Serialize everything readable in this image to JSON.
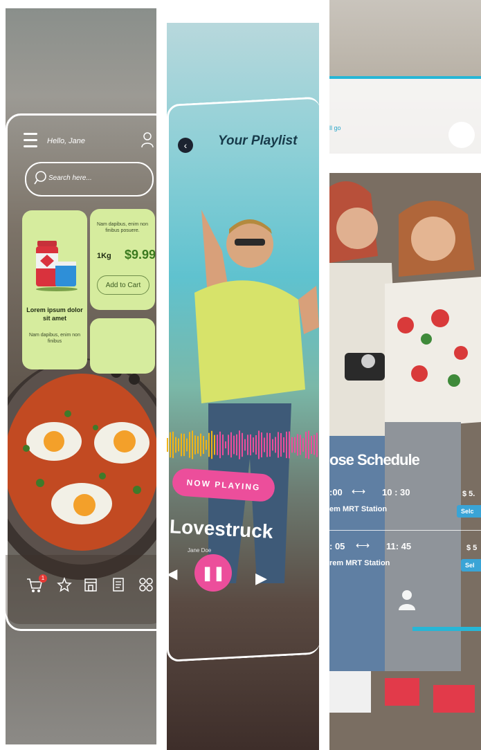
{
  "grocery": {
    "greeting": "Hello, Jane",
    "search_placeholder": "Search here...",
    "product1": {
      "title": "Lorem ipsum dolor sit amet",
      "description": "Nam dapibus, enim non finibus"
    },
    "product2": {
      "description": "Nam dapibus, enim non finibus posuere.",
      "weight": "1Kg",
      "price": "$9.99",
      "add_label": "Add to Cart"
    },
    "cart_badge": "1",
    "icons": [
      "menu-icon",
      "user-icon",
      "search-icon",
      "cart-icon",
      "star-icon",
      "store-icon",
      "receipt-icon",
      "grid-icon"
    ]
  },
  "music": {
    "title": "Your Playlist",
    "now_playing": "NOW PLAYING",
    "song": "Lovestruck",
    "artist": "Jane Doe",
    "colors": {
      "accent": "#ec4e9b",
      "wave_left": "#f2b416",
      "wave_right": "#ec4e9b"
    }
  },
  "travel": {
    "top_link": "ll go",
    "schedule_title": "ose Schedule",
    "rows": [
      {
        "depart": ":00",
        "arrive": "10 : 30",
        "station": "em MRT Station",
        "fare": "$ 5.",
        "select": "Selc"
      },
      {
        "depart": ": 05",
        "arrive": "11: 45",
        "station": "rem MRT Station",
        "fare": "$ 5",
        "select": "Sel"
      }
    ],
    "colors": {
      "accent": "#27b6d6",
      "button": "#3aa4d6"
    }
  }
}
